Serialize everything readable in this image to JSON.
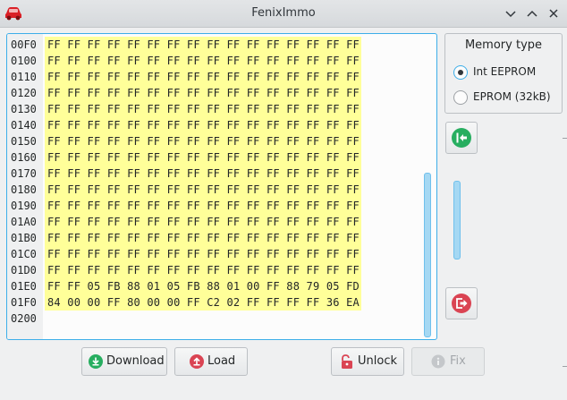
{
  "window": {
    "title": "FenixImmo"
  },
  "hex": {
    "rows": [
      {
        "addr": "00F0",
        "bytes": "FF FF FF FF FF FF FF FF FF FF FF FF FF FF FF FF"
      },
      {
        "addr": "0100",
        "bytes": "FF FF FF FF FF FF FF FF FF FF FF FF FF FF FF FF"
      },
      {
        "addr": "0110",
        "bytes": "FF FF FF FF FF FF FF FF FF FF FF FF FF FF FF FF"
      },
      {
        "addr": "0120",
        "bytes": "FF FF FF FF FF FF FF FF FF FF FF FF FF FF FF FF"
      },
      {
        "addr": "0130",
        "bytes": "FF FF FF FF FF FF FF FF FF FF FF FF FF FF FF FF"
      },
      {
        "addr": "0140",
        "bytes": "FF FF FF FF FF FF FF FF FF FF FF FF FF FF FF FF"
      },
      {
        "addr": "0150",
        "bytes": "FF FF FF FF FF FF FF FF FF FF FF FF FF FF FF FF"
      },
      {
        "addr": "0160",
        "bytes": "FF FF FF FF FF FF FF FF FF FF FF FF FF FF FF FF"
      },
      {
        "addr": "0170",
        "bytes": "FF FF FF FF FF FF FF FF FF FF FF FF FF FF FF FF"
      },
      {
        "addr": "0180",
        "bytes": "FF FF FF FF FF FF FF FF FF FF FF FF FF FF FF FF"
      },
      {
        "addr": "0190",
        "bytes": "FF FF FF FF FF FF FF FF FF FF FF FF FF FF FF FF"
      },
      {
        "addr": "01A0",
        "bytes": "FF FF FF FF FF FF FF FF FF FF FF FF FF FF FF FF"
      },
      {
        "addr": "01B0",
        "bytes": "FF FF FF FF FF FF FF FF FF FF FF FF FF FF FF FF"
      },
      {
        "addr": "01C0",
        "bytes": "FF FF FF FF FF FF FF FF FF FF FF FF FF FF FF FF"
      },
      {
        "addr": "01D0",
        "bytes": "FF FF FF FF FF FF FF FF FF FF FF FF FF FF FF FF"
      },
      {
        "addr": "01E0",
        "bytes": "FF FF 05 FB 88 01 05 FB 88 01 00 FF 88 79 05 FD"
      },
      {
        "addr": "01F0",
        "bytes": "84 00 00 FF 80 00 00 FF C2 02 FF FF FF FF 36 EA"
      },
      {
        "addr": "0200",
        "bytes": ""
      }
    ]
  },
  "memory_type": {
    "title": "Memory type",
    "options": [
      {
        "label": "Int EEPROM",
        "selected": true
      },
      {
        "label": "EPROM (32kB)",
        "selected": false
      }
    ]
  },
  "buttons": {
    "download": "Download",
    "load": "Load",
    "unlock": "Unlock",
    "fix": "Fix"
  },
  "icons": {
    "app": "car-icon",
    "minimize": "chevron-down-icon",
    "maximize": "chevron-up-icon",
    "close": "close-icon",
    "read_in": "import-arrow-icon",
    "write_out": "export-arrow-icon",
    "download": "download-icon",
    "load": "upload-icon",
    "unlock": "unlock-icon",
    "fix": "info-icon"
  },
  "colors": {
    "accent": "#3daee9",
    "hex_highlight": "#ffff99",
    "green": "#27ae60",
    "red": "#da4453"
  }
}
